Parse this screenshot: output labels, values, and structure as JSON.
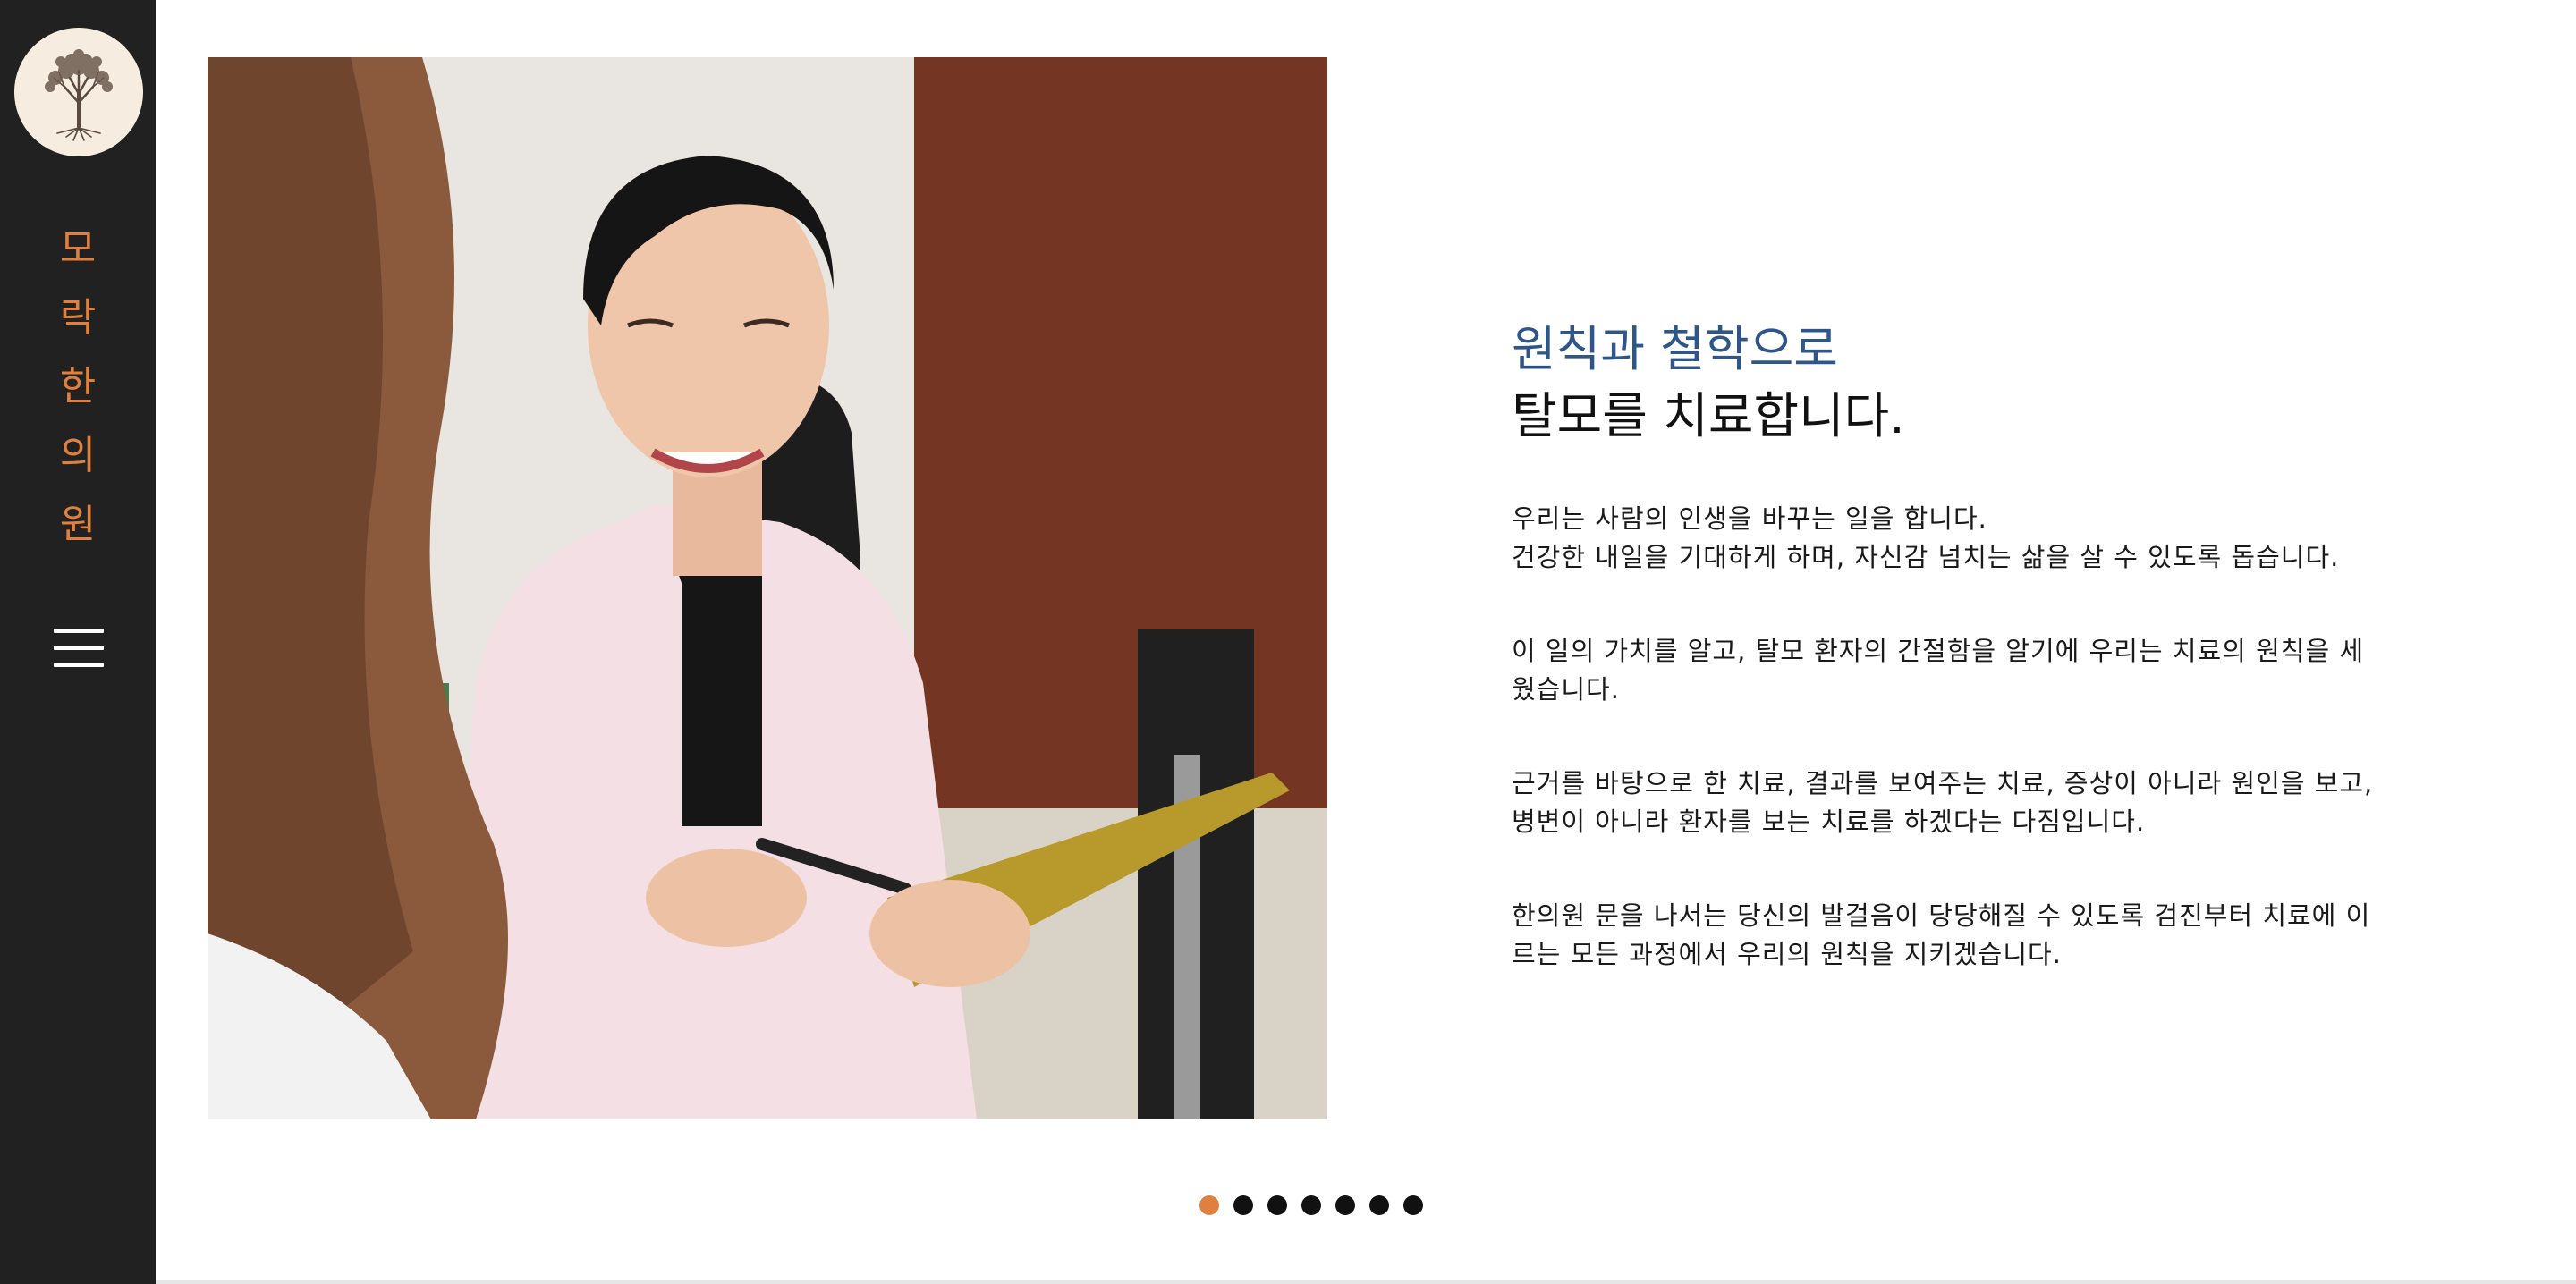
{
  "sidebar": {
    "logo_icon": "tree-of-life-icon",
    "brand_chars": [
      "모",
      "락",
      "한",
      "의",
      "원"
    ],
    "menu_icon": "hamburger-menu-icon"
  },
  "hero": {
    "heading_sub": "원칙과 철학으로",
    "heading_main": "탈모를 치료합니다.",
    "paragraphs": [
      {
        "lines": [
          "우리는 사람의 인생을 바꾸는 일을 합니다.",
          "건강한 내일을 기대하게 하며, 자신감 넘치는 삶을 살 수 있도록 돕습니다."
        ]
      },
      {
        "lines": [
          "이 일의 가치를 알고, 탈모 환자의 간절함을 알기에 우리는 치료의 원칙을 세",
          "웠습니다."
        ]
      },
      {
        "lines": [
          "근거를 바탕으로 한 치료, 결과를 보여주는 치료, 증상이 아니라 원인을 보고,",
          "병변이 아니라 환자를 보는 치료를 하겠다는 다짐입니다."
        ]
      },
      {
        "lines": [
          "한의원 문을 나서는 당신의 발걸음이 당당해질 수 있도록 검진부터 치료에 이",
          "르는 모든 과정에서 우리의 원칙을 지키겠습니다."
        ]
      }
    ]
  },
  "carousel": {
    "slide_count": 7,
    "active_index": 0
  },
  "colors": {
    "sidebar_bg": "#212121",
    "brand_accent": "#e0803f",
    "heading_blue": "#2e5688",
    "text_dark": "#111111"
  }
}
